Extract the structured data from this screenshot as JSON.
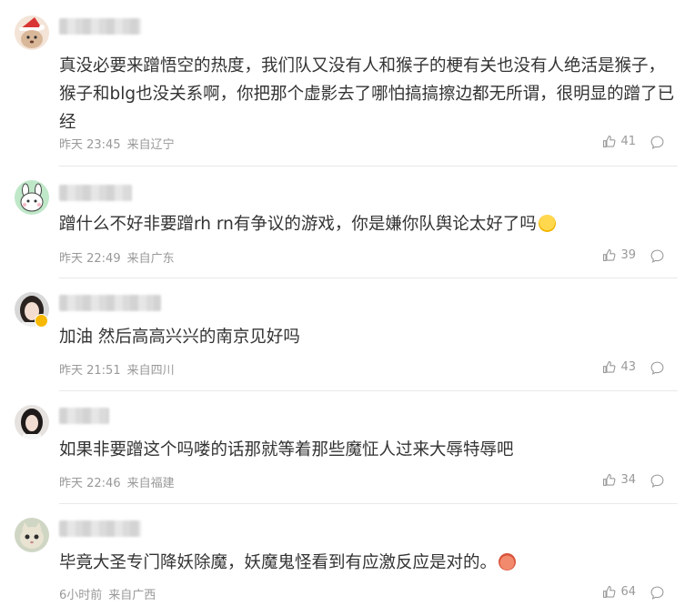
{
  "comments": [
    {
      "text": "真没必要来蹭悟空的热度，我们队又没有人和猴子的梗有关也没有人绝活是猴子，猴子和blg也没关系啊，你把那个虚影去了哪怕搞搞擦边都无所谓，很明显的蹭了已经",
      "time": "昨天 23:45",
      "location": "来自辽宁",
      "likes": "41",
      "avatar_icon": "christmas-dog-avatar"
    },
    {
      "text": "蹭什么不好非要蹭rh rn有争议的游戏，你是嫌你队舆论太好了吗",
      "time": "昨天 22:49",
      "location": "来自广东",
      "likes": "39",
      "avatar_icon": "cartoon-bunny-avatar",
      "emoji": "surprised-face-emoji"
    },
    {
      "text": "加油 然后高高兴兴的南京见好吗",
      "time": "昨天 21:51",
      "location": "来自四川",
      "likes": "43",
      "avatar_icon": "girl-photo-avatar"
    },
    {
      "text": "如果非要蹭这个吗喽的话那就等着那些魔怔人过来大辱特辱吧",
      "time": "昨天 22:46",
      "location": "来自福建",
      "likes": "34",
      "avatar_icon": "girl-photo-avatar"
    },
    {
      "text": "毕竟大圣专门降妖除魔，妖魔鬼怪看到有应激反应是对的。",
      "time": "6小时前",
      "location": "来自广西",
      "likes": "64",
      "avatar_icon": "cat-photo-avatar",
      "emoji": "pig-face-emoji"
    }
  ],
  "colors": {
    "meta": "#999999",
    "text": "#333333",
    "divider": "#e9e9e9"
  }
}
